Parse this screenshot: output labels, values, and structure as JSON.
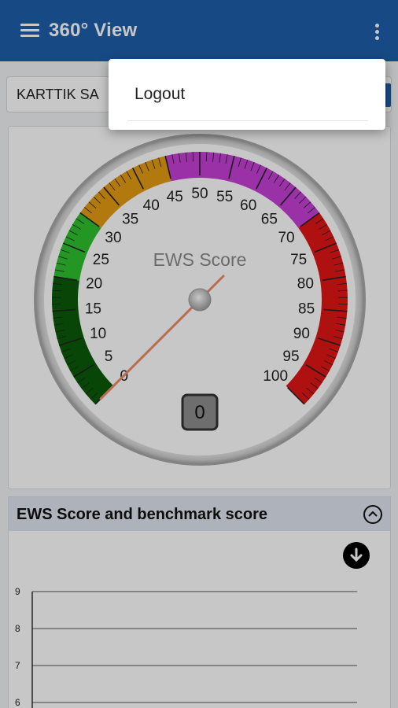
{
  "appbar": {
    "title": "360° View",
    "menu_icon": "hamburger-icon",
    "more_icon": "more-vert-icon"
  },
  "patient": {
    "name": "KARTTIK  SA"
  },
  "gauge": {
    "title": "EWS Score",
    "value": "0",
    "tick_labels": [
      "0",
      "5",
      "10",
      "15",
      "20",
      "25",
      "30",
      "35",
      "40",
      "45",
      "50",
      "55",
      "60",
      "65",
      "70",
      "75",
      "80",
      "85",
      "90",
      "95",
      "100"
    ],
    "bands": [
      {
        "from": 0,
        "to": 20,
        "color": "#0b5a0b"
      },
      {
        "from": 20,
        "to": 30,
        "color": "#2fc12f"
      },
      {
        "from": 30,
        "to": 45,
        "color": "#e49b12"
      },
      {
        "from": 45,
        "to": 70,
        "color": "#c63fd6"
      },
      {
        "from": 70,
        "to": 100,
        "color": "#e01515"
      }
    ]
  },
  "chart_section": {
    "title": "EWS Score and benchmark score",
    "collapse_icon": "chevron-up-circle-icon",
    "download_icon": "download-icon",
    "y_labels": [
      "9",
      "8",
      "7",
      "6"
    ]
  },
  "chart_data": {
    "type": "line",
    "title": "",
    "y_ticks": [
      9,
      8,
      7,
      6
    ],
    "series": []
  },
  "menu": {
    "items": [
      {
        "label": "Logout"
      }
    ]
  }
}
